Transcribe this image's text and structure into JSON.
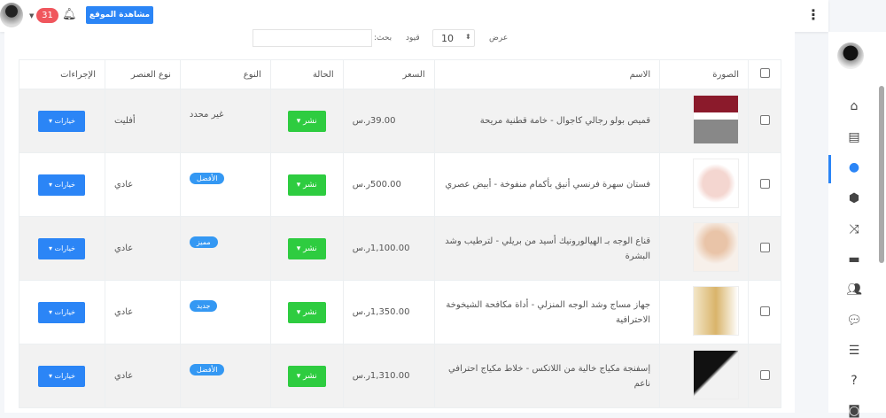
{
  "topbar": {
    "notifications": "31",
    "view_site": "مشاهدة الموقع"
  },
  "controls": {
    "show": "عرض",
    "page_size": "10",
    "entries": "قيود",
    "search_label": "بحث:"
  },
  "table": {
    "headers": [
      "الصورة",
      "الاسم",
      "السعر",
      "الحالة",
      "النوع",
      "نوع العنصر",
      "الإجراءات"
    ],
    "rows": [
      {
        "name": "قميص بولو رجالي كاجوال - خامة قطنية مريحة",
        "price": "39.00ر.س",
        "status": "نشر ▾",
        "type": "غير محدد",
        "type_badge": "",
        "element_type": "أفليت",
        "action": "خيارات ▾"
      },
      {
        "name": "فستان سهرة فرنسي أنيق بأكمام منفوخة - أبيض عصري",
        "price": "500.00ر.س",
        "status": "نشر ▾",
        "type": "",
        "type_badge": "الأفضل",
        "element_type": "عادي",
        "action": "خيارات ▾"
      },
      {
        "name": "قناع الوجه بـ الهيالورونيك أسيد من بريلي - لترطيب وشد البشرة",
        "price": "1,100.00ر.س",
        "status": "نشر ▾",
        "type": "",
        "type_badge": "مميز",
        "element_type": "عادي",
        "action": "خيارات ▾"
      },
      {
        "name": "جهاز مساج وشد الوجه المنزلي - أداة مكافحة الشيخوخة الاحترافية",
        "price": "1,350.00ر.س",
        "status": "نشر ▾",
        "type": "",
        "type_badge": "جديد",
        "element_type": "عادي",
        "action": "خيارات ▾"
      },
      {
        "name": "إسفنجة مكياج خالية من اللاتكس - خلاط مكياج احترافي ناعم",
        "price": "1,310.00ر.س",
        "status": "نشر ▾",
        "type": "",
        "type_badge": "الأفضل",
        "element_type": "عادي",
        "action": "خيارات ▾"
      }
    ]
  },
  "colors": {
    "primary": "#2b85f6",
    "success": "#2ecc40",
    "badge": "#f0565d"
  }
}
